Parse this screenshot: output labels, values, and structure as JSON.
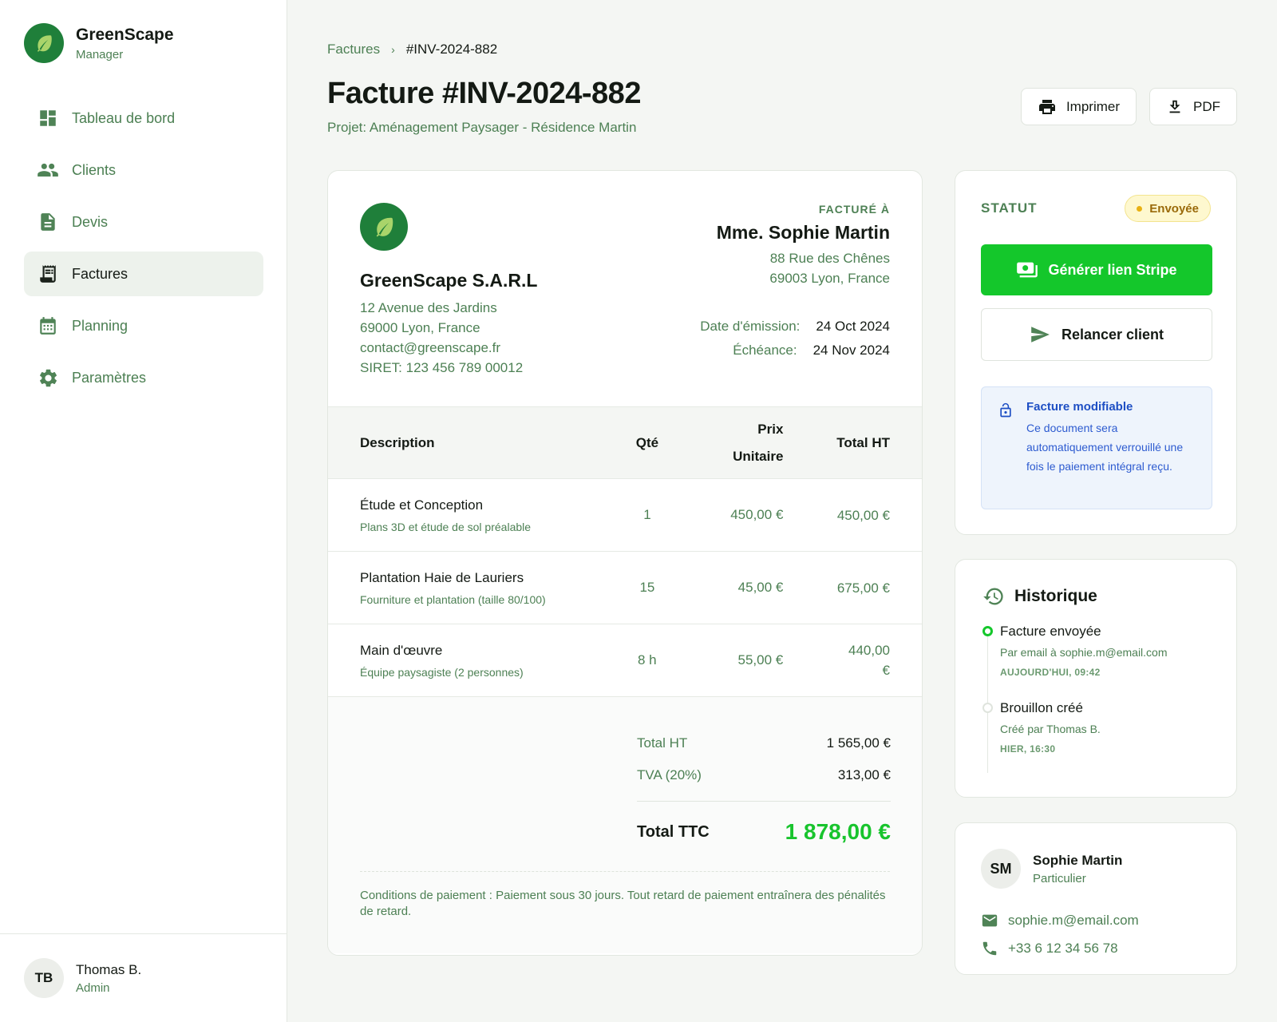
{
  "brand": {
    "name": "GreenScape",
    "role": "Manager"
  },
  "nav": [
    {
      "label": "Tableau de bord",
      "icon": "dashboard-icon"
    },
    {
      "label": "Clients",
      "icon": "people-icon"
    },
    {
      "label": "Devis",
      "icon": "document-icon"
    },
    {
      "label": "Factures",
      "icon": "receipt-icon",
      "active": true
    },
    {
      "label": "Planning",
      "icon": "calendar-icon"
    },
    {
      "label": "Paramètres",
      "icon": "gear-icon"
    }
  ],
  "user": {
    "initials": "TB",
    "name": "Thomas B.",
    "role": "Admin"
  },
  "breadcrumb": {
    "parent": "Factures",
    "separator": "›",
    "current": "#INV-2024-882"
  },
  "header": {
    "title": "Facture #INV-2024-882",
    "subtitle": "Projet: Aménagement Paysager - Résidence Martin",
    "print_label": "Imprimer",
    "pdf_label": "PDF"
  },
  "invoice": {
    "company": {
      "name": "GreenScape S.A.R.L",
      "address1": "12 Avenue des Jardins",
      "address2": "69000 Lyon, France",
      "email": "contact@greenscape.fr",
      "siret": "SIRET: 123 456 789 00012"
    },
    "bill_to": {
      "label": "FACTURÉ À",
      "name": "Mme. Sophie Martin",
      "address1": "88 Rue des Chênes",
      "address2": "69003 Lyon, France"
    },
    "dates": {
      "issue_label": "Date d'émission:",
      "issue_value": "24 Oct 2024",
      "due_label": "Échéance:",
      "due_value": "24 Nov 2024"
    },
    "columns": {
      "description": "Description",
      "qty": "Qté",
      "unit_price_1": "Prix",
      "unit_price_2": "Unitaire",
      "total": "Total HT"
    },
    "rows": [
      {
        "title": "Étude et Conception",
        "sub": "Plans 3D et étude de sol préalable",
        "qty": "1",
        "unit": "450,00 €",
        "total": "450,00 €"
      },
      {
        "title": "Plantation Haie de Lauriers",
        "sub": "Fourniture et plantation (taille 80/100)",
        "qty": "15",
        "unit": "45,00 €",
        "total": "675,00 €"
      },
      {
        "title": "Main d'œuvre",
        "sub": "Équipe paysagiste (2 personnes)",
        "qty": "8 h",
        "unit": "55,00 €",
        "total": "440,00 €"
      }
    ],
    "totals": {
      "ht_label": "Total HT",
      "ht_value": "1 565,00 €",
      "tva_label": "TVA (20%)",
      "tva_value": "313,00 €",
      "ttc_label": "Total TTC",
      "ttc_value": "1 878,00 €"
    },
    "conditions": "Conditions de paiement : Paiement sous 30 jours. Tout retard de paiement entraînera des pénalités de retard."
  },
  "status": {
    "label": "STATUT",
    "badge": "Envoyée",
    "stripe_button": "Générer lien Stripe",
    "remind_button": "Relancer client",
    "info_title": "Facture modifiable",
    "info_text": "Ce document sera automatiquement verrouillé une fois le paiement intégral reçu."
  },
  "history": {
    "title": "Historique",
    "events": [
      {
        "title": "Facture envoyée",
        "sub": "Par email à sophie.m@email.com",
        "time": "AUJOURD'HUI, 09:42"
      },
      {
        "title": "Brouillon créé",
        "sub": "Créé par Thomas B.",
        "time": "HIER, 16:30"
      }
    ]
  },
  "client": {
    "initials": "SM",
    "name": "Sophie Martin",
    "type": "Particulier",
    "email": "sophie.m@email.com",
    "phone": "+33 6 12 34 56 78"
  },
  "colors": {
    "brand_green": "#1f7f3a",
    "accent_green": "#14c72b",
    "muted_green": "#4d8054",
    "badge_bg": "#fef8cf",
    "info_blue": "#1e4fc4"
  }
}
